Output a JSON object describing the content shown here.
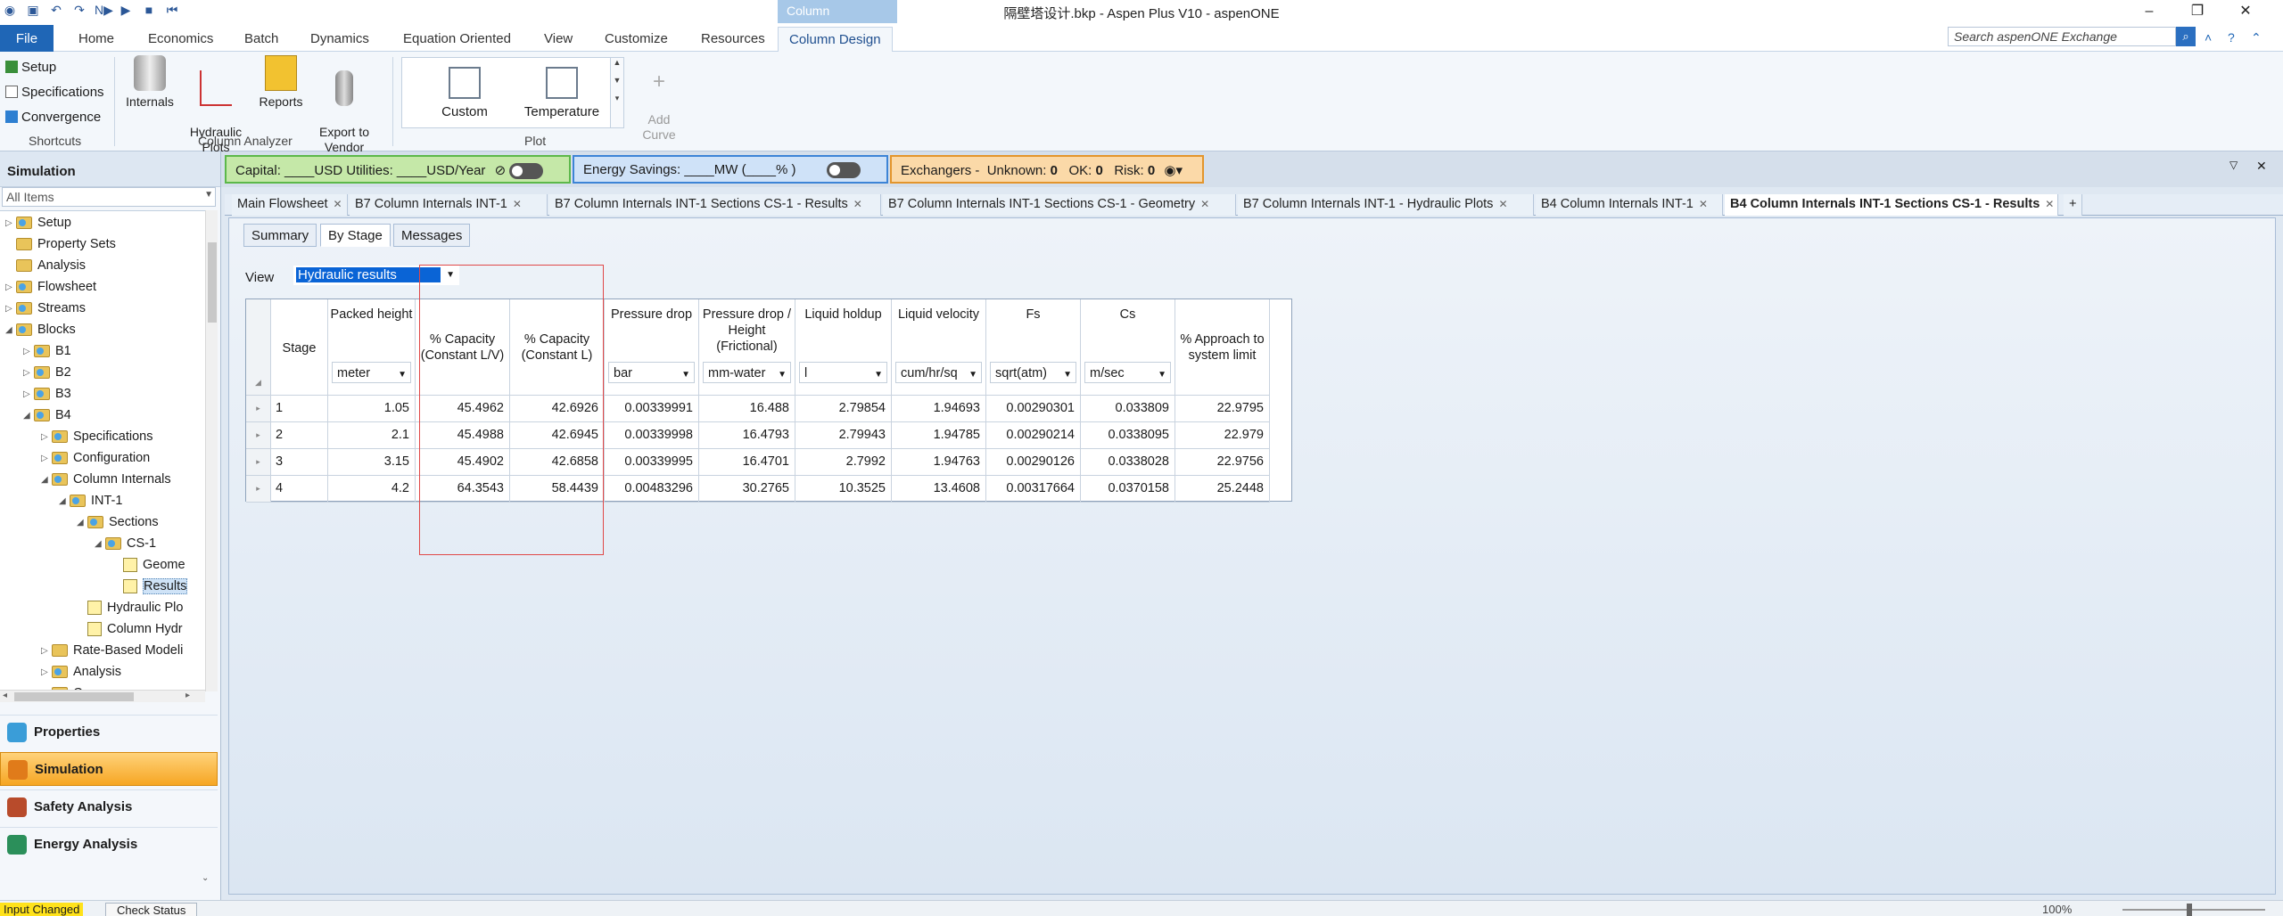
{
  "titlebar": {
    "title": "隔壁塔设计.bkp - Aspen Plus V10 - aspenONE",
    "context_group": "Column"
  },
  "ribbon_tabs": [
    "File",
    "Home",
    "Economics",
    "Batch",
    "Dynamics",
    "Equation Oriented",
    "View",
    "Customize",
    "Resources",
    "Column Design"
  ],
  "exchange_search_placeholder": "Search aspenONE Exchange",
  "ribbon": {
    "shortcuts": [
      "Setup",
      "Specifications",
      "Convergence"
    ],
    "shortcuts_label": "Shortcuts",
    "column_analyzer": [
      "Internals",
      "Hydraulic\nPlots",
      "Reports",
      "Export to\nVendor"
    ],
    "column_analyzer_label": "Column Analyzer",
    "plots": [
      "Custom",
      "Temperature"
    ],
    "add_curve": "Add\nCurve",
    "plot_label": "Plot"
  },
  "sidebar": {
    "title": "Simulation",
    "filter": "All Items",
    "tree": [
      {
        "label": "Setup",
        "level": 0,
        "exp": "▷",
        "icon": "folder-check"
      },
      {
        "label": "Property Sets",
        "level": 0,
        "exp": "",
        "icon": "folder"
      },
      {
        "label": "Analysis",
        "level": 0,
        "exp": "",
        "icon": "folder"
      },
      {
        "label": "Flowsheet",
        "level": 0,
        "exp": "▷",
        "icon": "folder-check"
      },
      {
        "label": "Streams",
        "level": 0,
        "exp": "▷",
        "icon": "folder-check"
      },
      {
        "label": "Blocks",
        "level": 0,
        "exp": "◢",
        "icon": "folder-check"
      },
      {
        "label": "B1",
        "level": 1,
        "exp": "▷",
        "icon": "folder-check"
      },
      {
        "label": "B2",
        "level": 1,
        "exp": "▷",
        "icon": "folder-check"
      },
      {
        "label": "B3",
        "level": 1,
        "exp": "▷",
        "icon": "folder-check"
      },
      {
        "label": "B4",
        "level": 1,
        "exp": "◢",
        "icon": "folder-check"
      },
      {
        "label": "Specifications",
        "level": 2,
        "exp": "▷",
        "icon": "folder-check"
      },
      {
        "label": "Configuration",
        "level": 2,
        "exp": "▷",
        "icon": "folder-check"
      },
      {
        "label": "Column Internals",
        "level": 2,
        "exp": "◢",
        "icon": "folder-check"
      },
      {
        "label": "INT-1",
        "level": 3,
        "exp": "◢",
        "icon": "folder-check"
      },
      {
        "label": "Sections",
        "level": 4,
        "exp": "◢",
        "icon": "folder-check"
      },
      {
        "label": "CS-1",
        "level": 5,
        "exp": "◢",
        "icon": "folder-check"
      },
      {
        "label": "Geome",
        "level": 6,
        "exp": "",
        "icon": "doc"
      },
      {
        "label": "Results",
        "level": 6,
        "exp": "",
        "icon": "doc",
        "selected": true
      },
      {
        "label": "Hydraulic Plo",
        "level": 4,
        "exp": "",
        "icon": "doc"
      },
      {
        "label": "Column Hydr",
        "level": 4,
        "exp": "",
        "icon": "doc"
      },
      {
        "label": "Rate-Based Modeli",
        "level": 2,
        "exp": "▷",
        "icon": "folder"
      },
      {
        "label": "Analysis",
        "level": 2,
        "exp": "▷",
        "icon": "folder-check"
      },
      {
        "label": "Convergence",
        "level": 2,
        "exp": "▷",
        "icon": "folder"
      }
    ],
    "nav": [
      {
        "label": "Properties",
        "active": false
      },
      {
        "label": "Simulation",
        "active": true
      },
      {
        "label": "Safety Analysis",
        "active": false
      },
      {
        "label": "Energy Analysis",
        "active": false
      }
    ]
  },
  "strip": {
    "capital": "Capital: ____USD   Utilities: ____USD/Year",
    "energy": "Energy Savings: ____MW    (____% )",
    "exchangers_label": "Exchangers -",
    "unknown_label": "Unknown:",
    "unknown": "0",
    "ok_label": "OK:",
    "ok": "0",
    "risk_label": "Risk:",
    "risk": "0"
  },
  "doc_tabs": [
    {
      "label": "Main Flowsheet",
      "active": false
    },
    {
      "label": "B7 Column Internals INT-1",
      "active": false
    },
    {
      "label": "B7 Column Internals INT-1 Sections CS-1 - Results",
      "active": false
    },
    {
      "label": "B7 Column Internals INT-1 Sections CS-1 - Geometry",
      "active": false
    },
    {
      "label": "B7 Column Internals INT-1 - Hydraulic Plots",
      "active": false
    },
    {
      "label": "B4 Column Internals INT-1",
      "active": false
    },
    {
      "label": "B4 Column Internals INT-1 Sections CS-1 - Results",
      "active": true
    }
  ],
  "form_tabs": [
    "Summary",
    "By Stage",
    "Messages"
  ],
  "view": {
    "label": "View",
    "value": "Hydraulic results"
  },
  "table": {
    "columns": [
      {
        "header": "Stage",
        "unit": null
      },
      {
        "header": "Packed height",
        "unit": "meter"
      },
      {
        "header": "% Capacity\n(Constant L/V)",
        "unit": null
      },
      {
        "header": "% Capacity\n(Constant L)",
        "unit": null
      },
      {
        "header": "Pressure drop",
        "unit": "bar"
      },
      {
        "header": "Pressure drop /\nHeight\n(Frictional)",
        "unit": "mm-water"
      },
      {
        "header": "Liquid holdup",
        "unit": "l"
      },
      {
        "header": "Liquid velocity",
        "unit": "cum/hr/sq"
      },
      {
        "header": "Fs",
        "unit": "sqrt(atm)"
      },
      {
        "header": "Cs",
        "unit": "m/sec"
      },
      {
        "header": "% Approach to\nsystem limit",
        "unit": null
      }
    ],
    "rows": [
      [
        "1",
        "1.05",
        "45.4962",
        "42.6926",
        "0.00339991",
        "16.488",
        "2.79854",
        "1.94693",
        "0.00290301",
        "0.033809",
        "22.9795"
      ],
      [
        "2",
        "2.1",
        "45.4988",
        "42.6945",
        "0.00339998",
        "16.4793",
        "2.79943",
        "1.94785",
        "0.00290214",
        "0.0338095",
        "22.979"
      ],
      [
        "3",
        "3.15",
        "45.4902",
        "42.6858",
        "0.00339995",
        "16.4701",
        "2.7992",
        "1.94763",
        "0.00290126",
        "0.0338028",
        "22.9756"
      ],
      [
        "4",
        "4.2",
        "64.3543",
        "58.4439",
        "0.00483296",
        "30.2765",
        "10.3525",
        "13.4608",
        "0.00317664",
        "0.0370158",
        "25.2448"
      ]
    ]
  },
  "status": {
    "changed": "Input Changed",
    "check": "Check Status",
    "zoom": "100%"
  }
}
